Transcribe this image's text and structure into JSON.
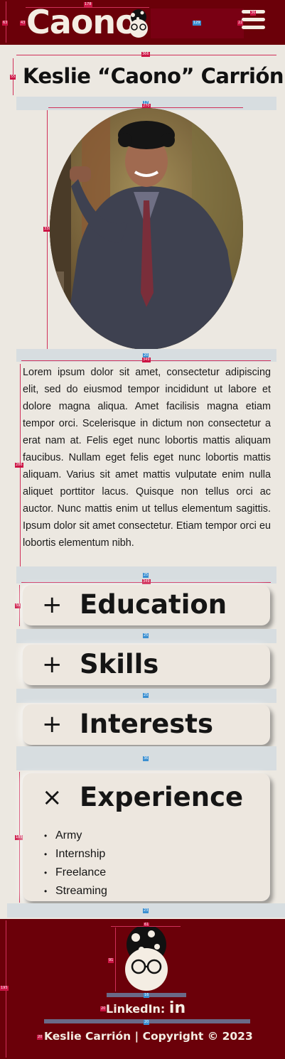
{
  "header": {
    "logo_text": "Caono",
    "menu_icon": "hamburger-icon",
    "brand_color": "#6b0009"
  },
  "measure": {
    "header_height": "63",
    "logo_width": "178",
    "logo_height": "43",
    "highlight_width": "129",
    "menu_width": "36",
    "menu_height": "22",
    "title_width": "366",
    "title_height": "55",
    "gap_photo": "17",
    "photo_width": "270",
    "photo_height": "338",
    "gap_bio": "20",
    "bio_width": "349",
    "bio_height": "286",
    "gap_1": "25",
    "acc_width": "349",
    "acc_height": "59",
    "gap_2": "25",
    "gap_3": "25",
    "gap_4": "36",
    "exp_height": "185",
    "gap_5": "23",
    "footer_height": "195",
    "ft_face_w": "61",
    "ft_face_h": "91",
    "ft_gap": "16",
    "link_h": "20",
    "ft_gap2": "20",
    "copy_h": "20"
  },
  "title": "Keslie “Caono” Carrión",
  "photo_alt": "Portrait photo",
  "bio": "Lorem ipsum dolor sit amet, consectetur adipiscing elit, sed do eiusmod tempor incididunt ut labore et dolore magna aliqua. Amet facilisis magna etiam tempor orci. Scelerisque in dictum non consectetur a erat nam at. Felis eget nunc lobortis mattis aliquam faucibus. Nullam eget felis eget nunc lobortis mattis aliquam. Varius sit amet mattis vulputate enim nulla aliquet porttitor lacus. Quisque non tellus orci ac auctor. Nunc mattis enim ut tellus elementum sagittis. Ipsum dolor sit amet consectetur. Etiam tempor orci eu lobortis elementum nibh.",
  "sections": {
    "education": {
      "symbol": "+",
      "label": "Education"
    },
    "skills": {
      "symbol": "+",
      "label": "Skills"
    },
    "interests": {
      "symbol": "+",
      "label": "Interests"
    },
    "experience": {
      "symbol": "×",
      "label": "Experience",
      "items": [
        "Army",
        "Internship",
        "Freelance",
        "Streaming"
      ]
    }
  },
  "footer": {
    "linkedin_label": "LinkedIn:",
    "linkedin_icon": "in",
    "copyright": "Keslie Carrión | Copyright © 2023"
  }
}
